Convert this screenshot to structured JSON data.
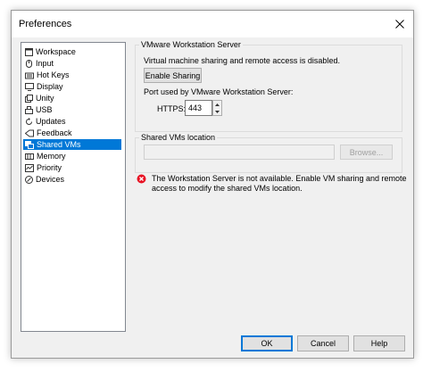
{
  "window": {
    "title": "Preferences"
  },
  "nav": {
    "items": [
      {
        "label": "Workspace",
        "icon": "workspace-icon",
        "selected": false
      },
      {
        "label": "Input",
        "icon": "mouse-icon",
        "selected": false
      },
      {
        "label": "Hot Keys",
        "icon": "keyboard-icon",
        "selected": false
      },
      {
        "label": "Display",
        "icon": "monitor-icon",
        "selected": false
      },
      {
        "label": "Unity",
        "icon": "unity-icon",
        "selected": false
      },
      {
        "label": "USB",
        "icon": "usb-icon",
        "selected": false
      },
      {
        "label": "Updates",
        "icon": "updates-icon",
        "selected": false
      },
      {
        "label": "Feedback",
        "icon": "feedback-icon",
        "selected": false
      },
      {
        "label": "Shared VMs",
        "icon": "shared-vms-icon",
        "selected": true
      },
      {
        "label": "Memory",
        "icon": "memory-icon",
        "selected": false
      },
      {
        "label": "Priority",
        "icon": "priority-icon",
        "selected": false
      },
      {
        "label": "Devices",
        "icon": "devices-icon",
        "selected": false
      }
    ]
  },
  "server": {
    "legend": "VMware Workstation Server",
    "status_text": "Virtual machine sharing and remote access is disabled.",
    "enable_button": "Enable Sharing",
    "port_label": "Port used by VMware Workstation Server:",
    "https_label": "HTTPS:",
    "https_value": "443"
  },
  "location": {
    "legend": "Shared VMs location",
    "path_value": "",
    "browse_button": "Browse..."
  },
  "error": {
    "line1": "The Workstation Server is not available. Enable VM sharing and remote",
    "line2": "access to modify the shared VMs location.",
    "color": "#e81123"
  },
  "buttons": {
    "ok": "OK",
    "cancel": "Cancel",
    "help": "Help"
  },
  "colors": {
    "accent": "#0078d7"
  }
}
